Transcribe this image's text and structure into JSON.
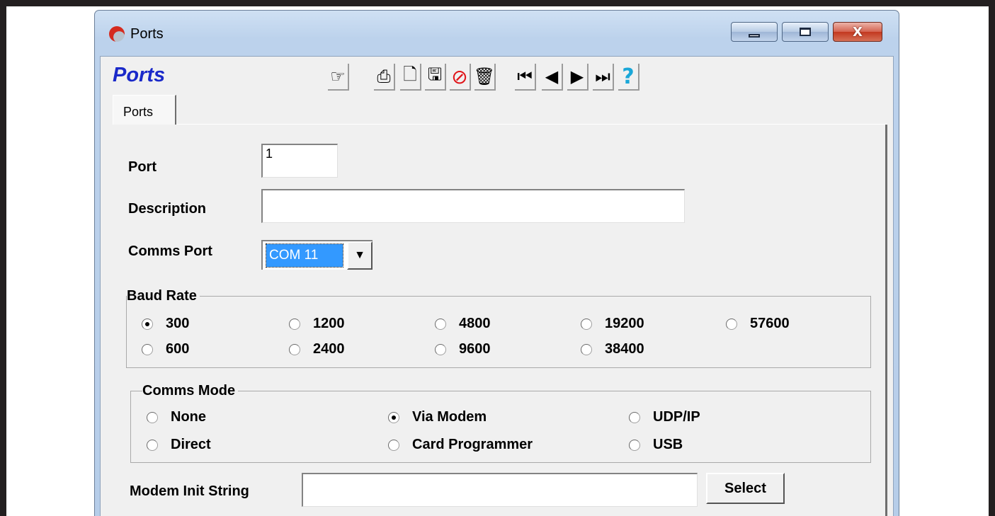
{
  "window": {
    "title": "Ports",
    "buttons": {
      "minimize": "▭",
      "maximize": "▢",
      "close": "X"
    }
  },
  "form": {
    "heading": "Ports"
  },
  "toolbar": [
    {
      "name": "open-record-icon",
      "glyph": "☞"
    },
    {
      "name": "print-icon",
      "glyph": "⎙"
    },
    {
      "name": "new-record-icon",
      "glyph": "🗋"
    },
    {
      "name": "save-icon",
      "glyph": "🖫"
    },
    {
      "name": "cancel-icon",
      "glyph": "⊘"
    },
    {
      "name": "delete-icon",
      "glyph": "🗑"
    },
    {
      "name": "first-record-icon",
      "glyph": "⏮"
    },
    {
      "name": "previous-record-icon",
      "glyph": "◀"
    },
    {
      "name": "next-record-icon",
      "glyph": "▶"
    },
    {
      "name": "last-record-icon",
      "glyph": "⏭"
    },
    {
      "name": "help-icon",
      "glyph": "?"
    }
  ],
  "tabs": [
    {
      "label": "Ports",
      "active": true
    }
  ],
  "fields": {
    "port": {
      "label": "Port",
      "value": "1"
    },
    "description": {
      "label": "Description",
      "value": ""
    },
    "comms_port": {
      "label": "Comms Port",
      "value": "COM 11"
    },
    "modem_init": {
      "label": "Modem Init String",
      "value": "",
      "button": "Select"
    }
  },
  "baud_rate": {
    "title": "Baud Rate",
    "options": [
      "300",
      "1200",
      "4800",
      "19200",
      "57600",
      "600",
      "2400",
      "9600",
      "38400"
    ],
    "selected": "300"
  },
  "comms_mode": {
    "title": "Comms Mode",
    "options": [
      "None",
      "Via Modem",
      "UDP/IP",
      "Direct",
      "Card Programmer",
      "USB"
    ],
    "selected": "Via Modem"
  }
}
